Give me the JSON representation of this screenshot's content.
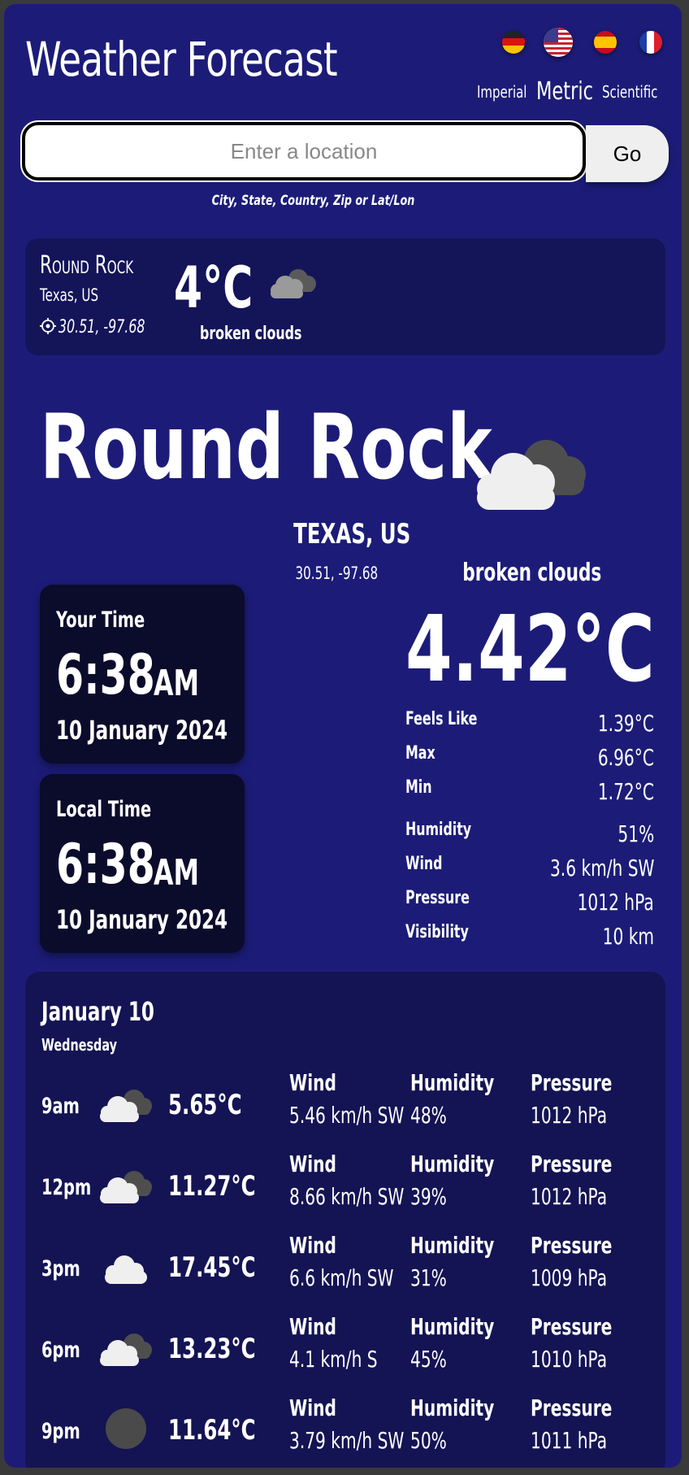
{
  "app": {
    "title": "Weather Forecast"
  },
  "units": {
    "imperial": "Imperial",
    "metric": "Metric",
    "scientific": "Scientific",
    "selected": "Metric"
  },
  "search": {
    "placeholder": "Enter a location",
    "button": "Go",
    "hint": "City, State, Country, Zip or Lat/Lon"
  },
  "summary": {
    "city": "Round Rock",
    "region": "Texas, US",
    "coords": "30.51, -97.68",
    "temp": "4°C",
    "condition": "broken clouds"
  },
  "current": {
    "city": "Round Rock",
    "region": "TEXAS, US",
    "coords": "30.51, -97.68",
    "condition": "broken clouds",
    "temp": "4.42°C",
    "your_time": {
      "label": "Your Time",
      "time": "6:38",
      "ampm": "AM",
      "date": "10 January 2024"
    },
    "local_time": {
      "label": "Local Time",
      "time": "6:38",
      "ampm": "AM",
      "date": "10 January 2024"
    },
    "details": [
      {
        "label": "Feels Like",
        "value": "1.39°C"
      },
      {
        "label": "Max",
        "value": "6.96°C"
      },
      {
        "label": "Min",
        "value": "1.72°C"
      },
      {
        "label": "Humidity",
        "value": "51%"
      },
      {
        "label": "Wind",
        "value": "3.6 km/h SW"
      },
      {
        "label": "Pressure",
        "value": "1012 hPa"
      },
      {
        "label": "Visibility",
        "value": "10 km"
      }
    ]
  },
  "forecast": {
    "date": "January 10",
    "weekday": "Wednesday",
    "labels": {
      "wind": "Wind",
      "humidity": "Humidity",
      "pressure": "Pressure"
    },
    "rows": [
      {
        "time": "9am",
        "icon": "broken-clouds-icon",
        "temp": "5.65°C",
        "wind": "5.46 km/h SW",
        "humidity": "48%",
        "pressure": "1012 hPa"
      },
      {
        "time": "12pm",
        "icon": "broken-clouds-icon",
        "temp": "11.27°C",
        "wind": "8.66 km/h SW",
        "humidity": "39%",
        "pressure": "1012 hPa"
      },
      {
        "time": "3pm",
        "icon": "cloud-icon",
        "temp": "17.45°C",
        "wind": "6.6 km/h SW",
        "humidity": "31%",
        "pressure": "1009 hPa"
      },
      {
        "time": "6pm",
        "icon": "broken-clouds-icon",
        "temp": "13.23°C",
        "wind": "4.1 km/h S",
        "humidity": "45%",
        "pressure": "1010 hPa"
      },
      {
        "time": "9pm",
        "icon": "moon-icon",
        "temp": "11.64°C",
        "wind": "3.79 km/h SW",
        "humidity": "50%",
        "pressure": "1011 hPa"
      }
    ]
  }
}
